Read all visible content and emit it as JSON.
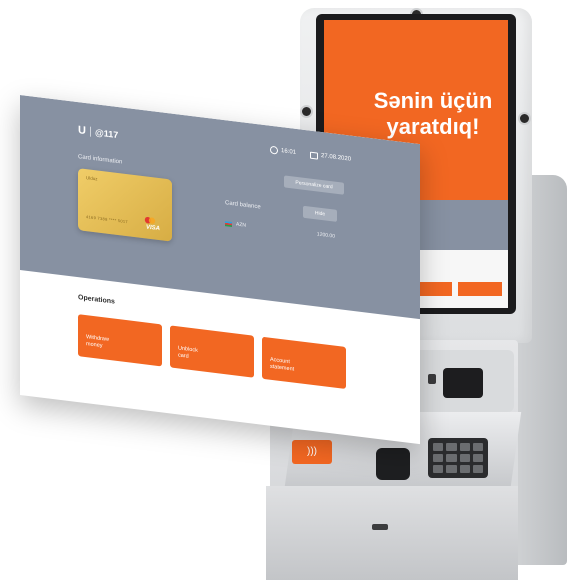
{
  "kiosk": {
    "slogan_line1": "Sənin üçün",
    "slogan_line2": "yaratdıq!",
    "brand_color": "#f26722"
  },
  "app": {
    "logo_left": "U",
    "logo_right": "@117",
    "time": "16:01",
    "date": "27.08.2020",
    "header_bg": "#8791a2",
    "card_information_label": "Card information",
    "card_action_button": "Personalize card",
    "card": {
      "holder": "Ulduz",
      "number": "4169 7388 **** 5017",
      "network": "VISA"
    },
    "card_balance_label": "Card balance",
    "balance_hide_button": "Hide",
    "balance": {
      "currency": "AZN",
      "amount": "1200.00"
    },
    "operations_title": "Operations",
    "operations": [
      {
        "label_line1": "Withdraw",
        "label_line2": "money"
      },
      {
        "label_line1": "Unblock",
        "label_line2": "card"
      },
      {
        "label_line1": "Account",
        "label_line2": "statement"
      }
    ]
  },
  "icons": [
    "clock-icon",
    "calendar-icon",
    "mastercard-icon",
    "flag-icon",
    "camera-icon",
    "nfc-icon"
  ]
}
